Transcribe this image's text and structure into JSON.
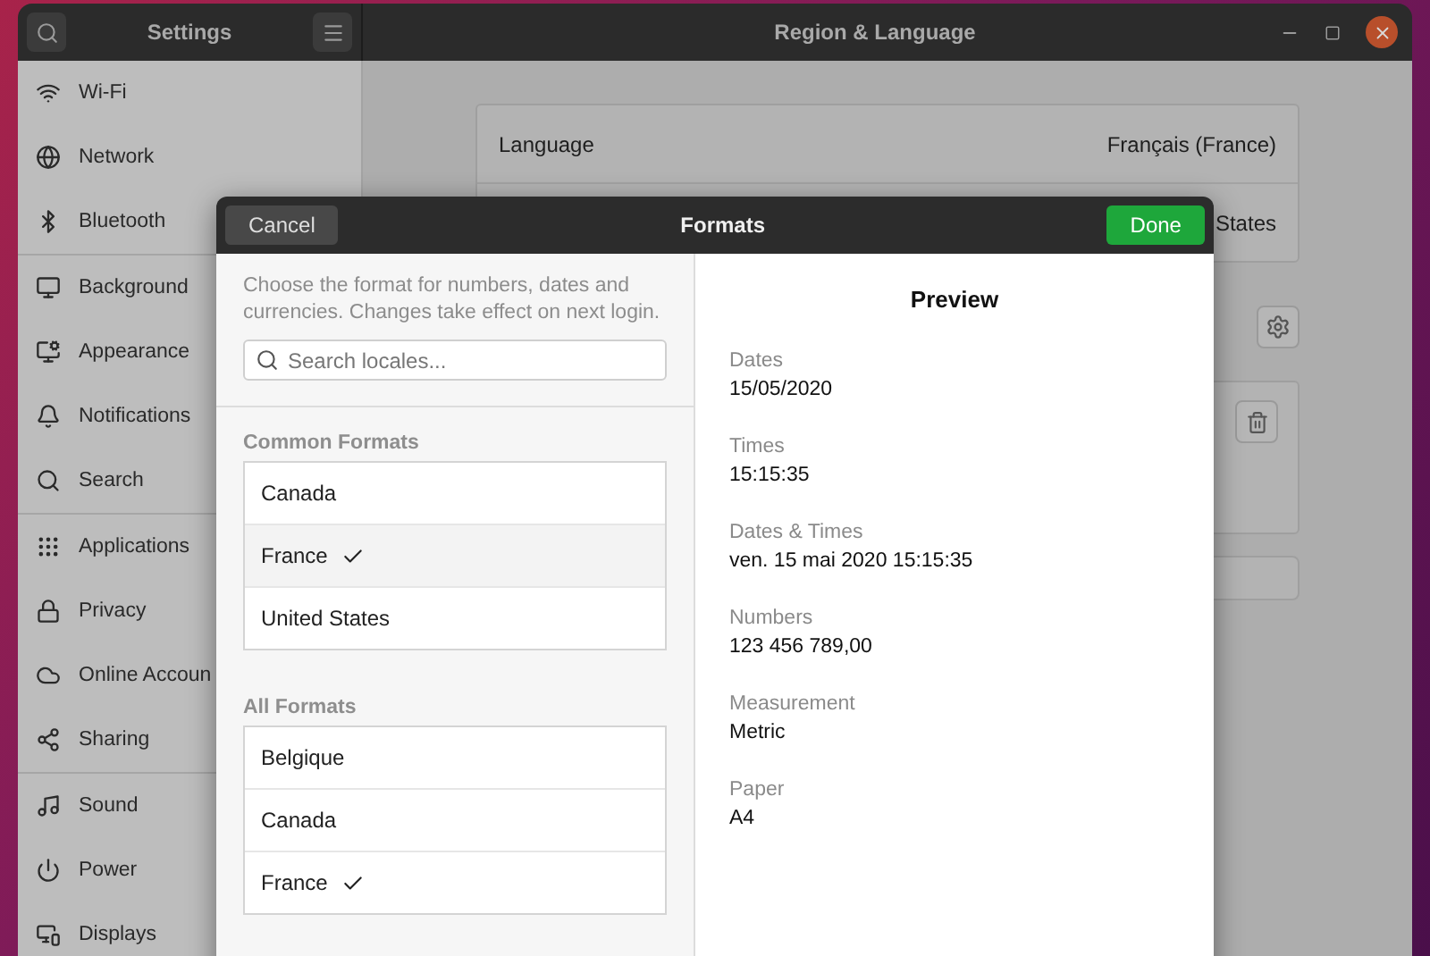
{
  "settings_window": {
    "title": "Settings",
    "page_title": "Region & Language"
  },
  "sidebar": {
    "sections": [
      [
        {
          "label": "Wi-Fi"
        },
        {
          "label": "Network"
        },
        {
          "label": "Bluetooth"
        }
      ],
      [
        {
          "label": "Background"
        },
        {
          "label": "Appearance"
        },
        {
          "label": "Notifications"
        },
        {
          "label": "Search"
        }
      ],
      [
        {
          "label": "Applications"
        },
        {
          "label": "Privacy"
        },
        {
          "label": "Online Accoun"
        },
        {
          "label": "Sharing"
        }
      ],
      [
        {
          "label": "Sound"
        },
        {
          "label": "Power"
        },
        {
          "label": "Displays"
        }
      ]
    ]
  },
  "region_rows": [
    {
      "label": "Language",
      "value": "Français (France)"
    },
    {
      "value": "States"
    }
  ],
  "formats_dialog": {
    "title": "Formats",
    "cancel": "Cancel",
    "done": "Done",
    "description": "Choose the format for numbers, dates and currencies. Changes take effect on next login.",
    "search": {
      "placeholder": "Search locales..."
    },
    "groups": [
      {
        "heading": "Common Formats",
        "items": [
          {
            "label": "Canada",
            "selected": false,
            "hovered": false
          },
          {
            "label": "France",
            "selected": true,
            "hovered": true
          },
          {
            "label": "United States",
            "selected": false,
            "hovered": false
          }
        ]
      },
      {
        "heading": "All Formats",
        "items": [
          {
            "label": "Belgique",
            "selected": false,
            "hovered": false
          },
          {
            "label": "Canada",
            "selected": false,
            "hovered": false
          },
          {
            "label": "France",
            "selected": true,
            "hovered": false
          }
        ]
      }
    ],
    "preview": {
      "title": "Preview",
      "fields": [
        {
          "label": "Dates",
          "value": "15/05/2020"
        },
        {
          "label": "Times",
          "value": "15:15:35"
        },
        {
          "label": "Dates & Times",
          "value": "ven. 15 mai 2020 15:15:35"
        },
        {
          "label": "Numbers",
          "value": "123 456 789,00"
        },
        {
          "label": "Measurement",
          "value": "Metric"
        },
        {
          "label": "Paper",
          "value": "A4"
        }
      ]
    }
  }
}
